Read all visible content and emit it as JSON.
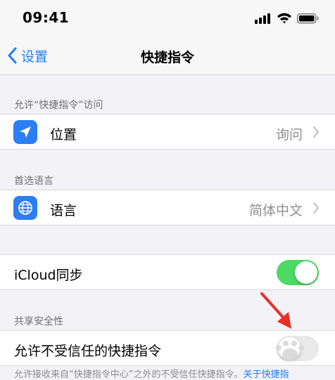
{
  "status_bar": {
    "time": "09:41"
  },
  "nav": {
    "back_label": "设置",
    "title": "快捷指令"
  },
  "sections": {
    "access": {
      "header": "允许“快捷指令”访问",
      "row": {
        "label": "位置",
        "value": "询问",
        "icon": "location-arrow-icon"
      }
    },
    "language": {
      "header": "首选语言",
      "row": {
        "label": "语言",
        "value": "简体中文",
        "icon": "globe-icon"
      }
    },
    "icloud": {
      "label": "iCloud同步",
      "toggle_on": true
    },
    "sharing": {
      "header": "共享安全性",
      "row": {
        "label": "允许不受信任的快捷指令",
        "toggle_on": false
      },
      "footer": "允许接收来自“快捷指令中心”之外的不受信任快捷指令。",
      "footer_link": "关于快捷指"
    }
  },
  "colors": {
    "accent": "#1e7ef7",
    "toggle_on": "#4cd964",
    "toggle_off": "#e9e9ea",
    "icon_bg": "#2b7ef5",
    "annotation_arrow": "#e8302a"
  }
}
